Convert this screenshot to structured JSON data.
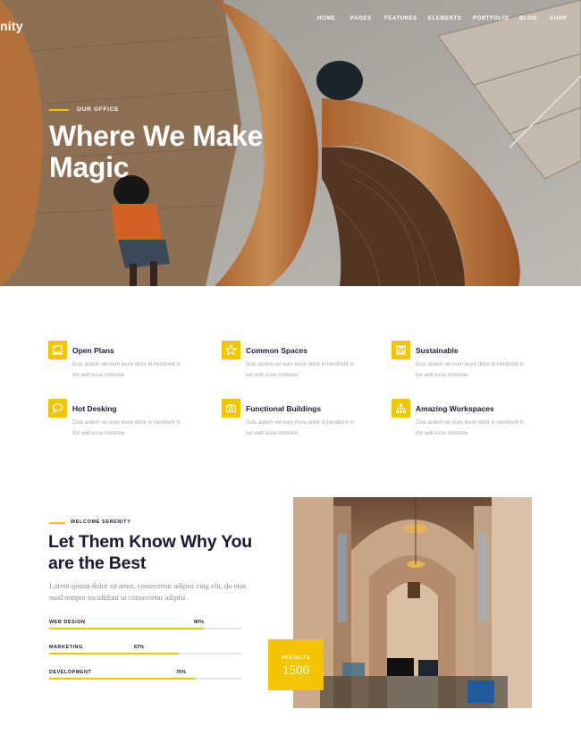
{
  "header": {
    "logo": "nity",
    "nav": [
      "HOME",
      "PAGES",
      "FEATURES",
      "ELEMENTS",
      "PORTFOLIO",
      "BLOG",
      "SHOP"
    ]
  },
  "hero": {
    "eyebrow": "OUR OFFICE",
    "title": "Where We Make Magic"
  },
  "features": [
    {
      "title": "Open Plans",
      "desc": "Duis autem vel eum iriure dolor in hendrerit in vul velit esse molestie",
      "icon": "laptop-icon"
    },
    {
      "title": "Common Spaces",
      "desc": "Duis autem vel eum iriure dolor in hendrerit in vul velit esse molestie",
      "icon": "star-icon"
    },
    {
      "title": "Sustainable",
      "desc": "Duis autem vel eum iriure dolor in hendrerit in vul velit esse molestie",
      "icon": "save-icon"
    },
    {
      "title": "Hot Desking",
      "desc": "Duis autem vel eum iriure dolor in hendrerit in vul velit esse molestie",
      "icon": "chat-icon"
    },
    {
      "title": "Functional Buildings",
      "desc": "Duis autem vel eum iriure dolor in hendrerit in vul velit esse molestie",
      "icon": "camera-icon"
    },
    {
      "title": "Amazing Workspaces",
      "desc": "Duis autem vel eum iriure dolor in hendrerit in vul velit esse molestie",
      "icon": "sitemap-icon"
    }
  ],
  "about": {
    "eyebrow": "WELCOME SERENITY",
    "title": "Let Them Know Why You are the Best",
    "text": "Lorem ipsum dolor sit amet, consectetur adipisi cing elit, do eius mod tempor incididunt ut consectetur adipisi.",
    "skills": [
      {
        "label": "WEB DESIGN",
        "value": "80%",
        "fraction": 0.8
      },
      {
        "label": "MARKETING",
        "value": "67%",
        "fraction": 0.67
      },
      {
        "label": "DEVELOPMENT",
        "value": "76%",
        "fraction": 0.76
      }
    ],
    "projects_label": "PROJECTS",
    "projects_value": "1500"
  },
  "colors": {
    "accent": "#f5c400",
    "heading": "#1b1b2f",
    "muted": "#a7a7a7"
  }
}
